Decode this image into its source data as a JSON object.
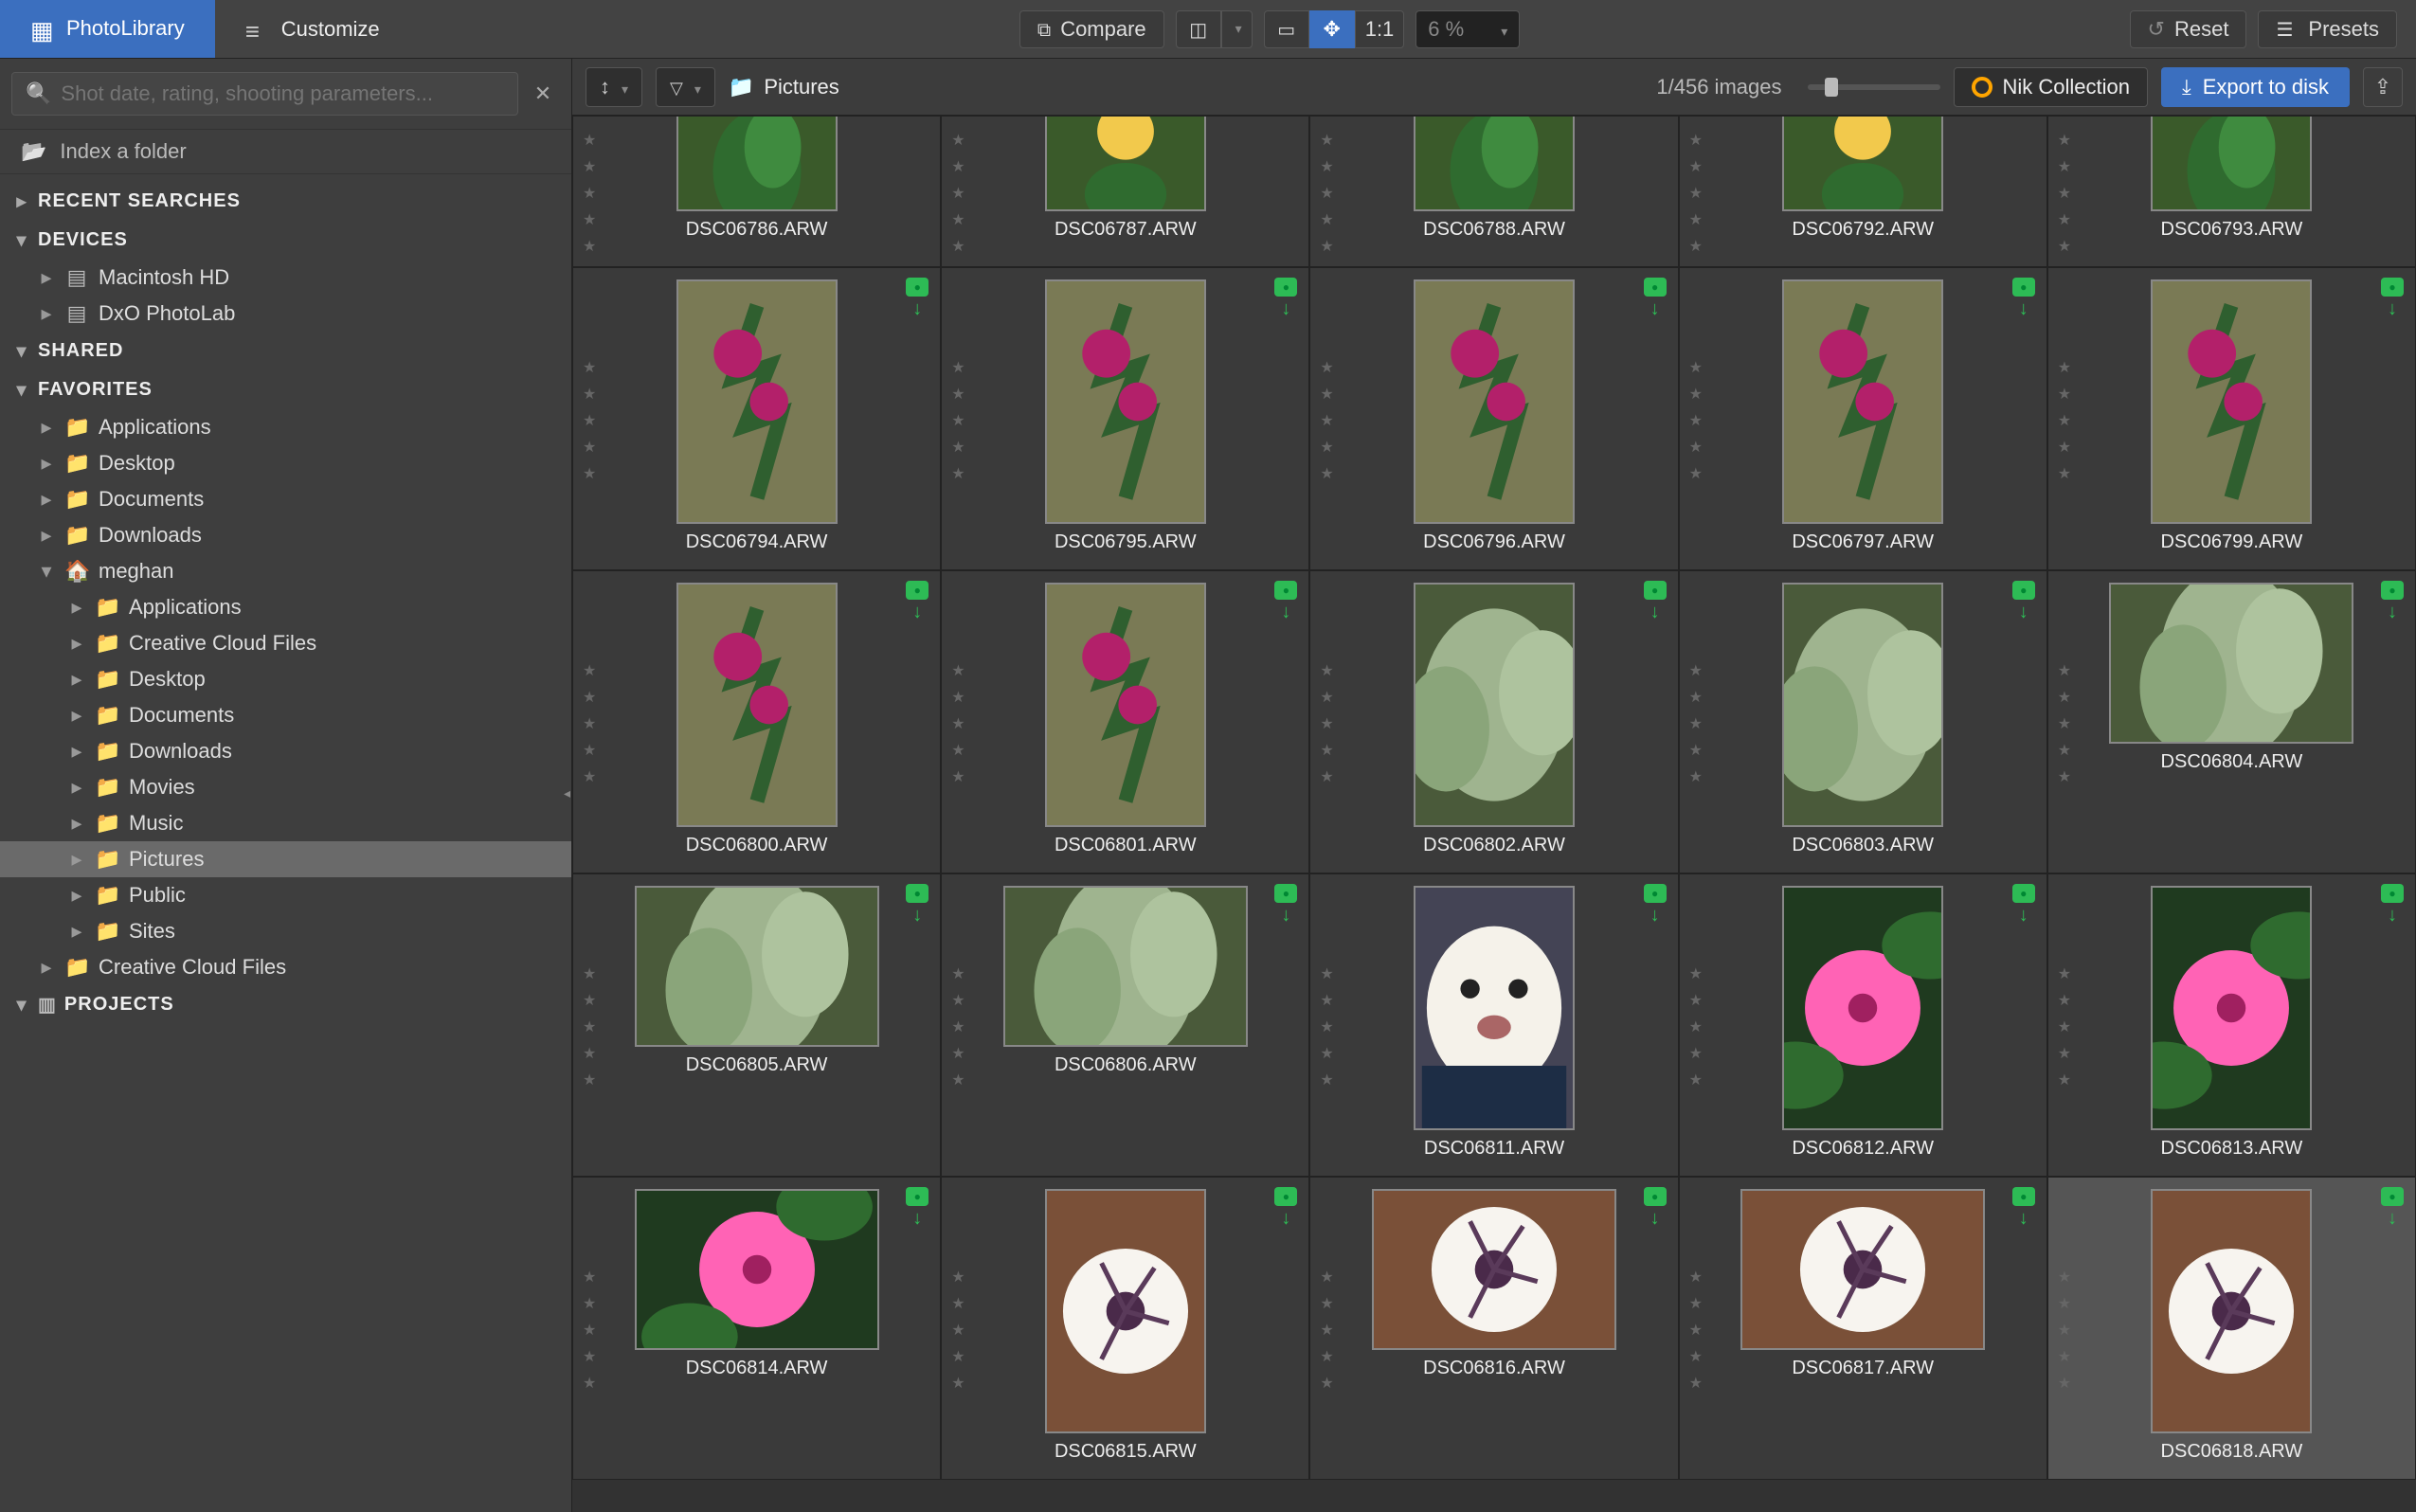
{
  "topbar": {
    "tab_library": "PhotoLibrary",
    "tab_customize": "Customize",
    "compare": "Compare",
    "ratio_11": "1:1",
    "zoom_pct": "6 %",
    "reset": "Reset",
    "presets": "Presets"
  },
  "subbar": {
    "breadcrumb": "Pictures",
    "count": "1/456 images",
    "nik": "Nik Collection",
    "export": "Export to disk"
  },
  "leftpanel": {
    "search_placeholder": "Shot date, rating, shooting parameters...",
    "index_folder": "Index a folder",
    "headers": {
      "recent": "RECENT SEARCHES",
      "devices": "DEVICES",
      "shared": "SHARED",
      "favorites": "FAVORITES",
      "projects": "PROJECTS"
    },
    "devices": [
      {
        "label": "Macintosh HD",
        "icon": "disk"
      },
      {
        "label": "DxO PhotoLab",
        "icon": "disk"
      }
    ],
    "favorites": [
      {
        "label": "Applications",
        "icon": "folder",
        "indent": 1,
        "tw": "▸"
      },
      {
        "label": "Desktop",
        "icon": "folder",
        "indent": 1,
        "tw": "▸"
      },
      {
        "label": "Documents",
        "icon": "folder",
        "indent": 1,
        "tw": "▸"
      },
      {
        "label": "Downloads",
        "icon": "folder",
        "indent": 1,
        "tw": "▸"
      },
      {
        "label": "meghan",
        "icon": "home",
        "indent": 1,
        "tw": "▾"
      },
      {
        "label": "Applications",
        "icon": "folder",
        "indent": 2,
        "tw": "▸"
      },
      {
        "label": "Creative Cloud Files",
        "icon": "folder",
        "indent": 2,
        "tw": "▸"
      },
      {
        "label": "Desktop",
        "icon": "folder",
        "indent": 2,
        "tw": "▸"
      },
      {
        "label": "Documents",
        "icon": "folder",
        "indent": 2,
        "tw": "▸"
      },
      {
        "label": "Downloads",
        "icon": "folder",
        "indent": 2,
        "tw": "▸"
      },
      {
        "label": "Movies",
        "icon": "folder",
        "indent": 2,
        "tw": "▸"
      },
      {
        "label": "Music",
        "icon": "folder",
        "indent": 2,
        "tw": "▸"
      },
      {
        "label": "Pictures",
        "icon": "folder",
        "indent": 2,
        "tw": "▸",
        "selected": true
      },
      {
        "label": "Public",
        "icon": "folder",
        "indent": 2,
        "tw": "▸"
      },
      {
        "label": "Sites",
        "icon": "folder",
        "indent": 2,
        "tw": "▸"
      },
      {
        "label": "Creative Cloud Files",
        "icon": "folder",
        "indent": 1,
        "tw": "▸"
      }
    ]
  },
  "thumbs": [
    {
      "name": "DSC06786.ARW",
      "shape": "partialcrop",
      "kind": "leaf",
      "row": "partial",
      "badges": false
    },
    {
      "name": "DSC06787.ARW",
      "shape": "partialcrop",
      "kind": "yellowflower",
      "row": "partial",
      "badges": false
    },
    {
      "name": "DSC06788.ARW",
      "shape": "partialcrop",
      "kind": "leaf",
      "row": "partial",
      "badges": false
    },
    {
      "name": "DSC06792.ARW",
      "shape": "partialcrop",
      "kind": "yellowflower",
      "row": "partial",
      "badges": false
    },
    {
      "name": "DSC06793.ARW",
      "shape": "partialcrop",
      "kind": "leaf",
      "row": "partial",
      "badges": false
    },
    {
      "name": "DSC06794.ARW",
      "shape": "portrait",
      "kind": "magenta",
      "badges": true
    },
    {
      "name": "DSC06795.ARW",
      "shape": "portrait",
      "kind": "magenta",
      "badges": true
    },
    {
      "name": "DSC06796.ARW",
      "shape": "portrait",
      "kind": "magenta",
      "badges": true
    },
    {
      "name": "DSC06797.ARW",
      "shape": "portrait",
      "kind": "magenta",
      "badges": true
    },
    {
      "name": "DSC06799.ARW",
      "shape": "portrait",
      "kind": "magenta",
      "badges": true
    },
    {
      "name": "DSC06800.ARW",
      "shape": "portrait",
      "kind": "magenta",
      "badges": true
    },
    {
      "name": "DSC06801.ARW",
      "shape": "portrait",
      "kind": "magenta",
      "badges": true
    },
    {
      "name": "DSC06802.ARW",
      "shape": "portrait",
      "kind": "sage",
      "badges": true
    },
    {
      "name": "DSC06803.ARW",
      "shape": "portrait",
      "kind": "sage",
      "badges": true
    },
    {
      "name": "DSC06804.ARW",
      "shape": "landscape",
      "kind": "sage",
      "badges": true
    },
    {
      "name": "DSC06805.ARW",
      "shape": "landscape",
      "kind": "sage",
      "badges": true
    },
    {
      "name": "DSC06806.ARW",
      "shape": "landscape",
      "kind": "sage",
      "badges": true
    },
    {
      "name": "DSC06811.ARW",
      "shape": "portrait",
      "kind": "dog",
      "badges": true
    },
    {
      "name": "DSC06812.ARW",
      "shape": "portrait",
      "kind": "pink",
      "badges": true
    },
    {
      "name": "DSC06813.ARW",
      "shape": "portrait",
      "kind": "pink",
      "badges": true
    },
    {
      "name": "DSC06814.ARW",
      "shape": "landscape",
      "kind": "pink",
      "badges": true
    },
    {
      "name": "DSC06815.ARW",
      "shape": "portrait",
      "kind": "white",
      "badges": true
    },
    {
      "name": "DSC06816.ARW",
      "shape": "landscape",
      "kind": "white",
      "badges": true
    },
    {
      "name": "DSC06817.ARW",
      "shape": "landscape",
      "kind": "white",
      "badges": true
    },
    {
      "name": "DSC06818.ARW",
      "shape": "portrait",
      "kind": "white",
      "badges": true,
      "selected": true
    }
  ]
}
